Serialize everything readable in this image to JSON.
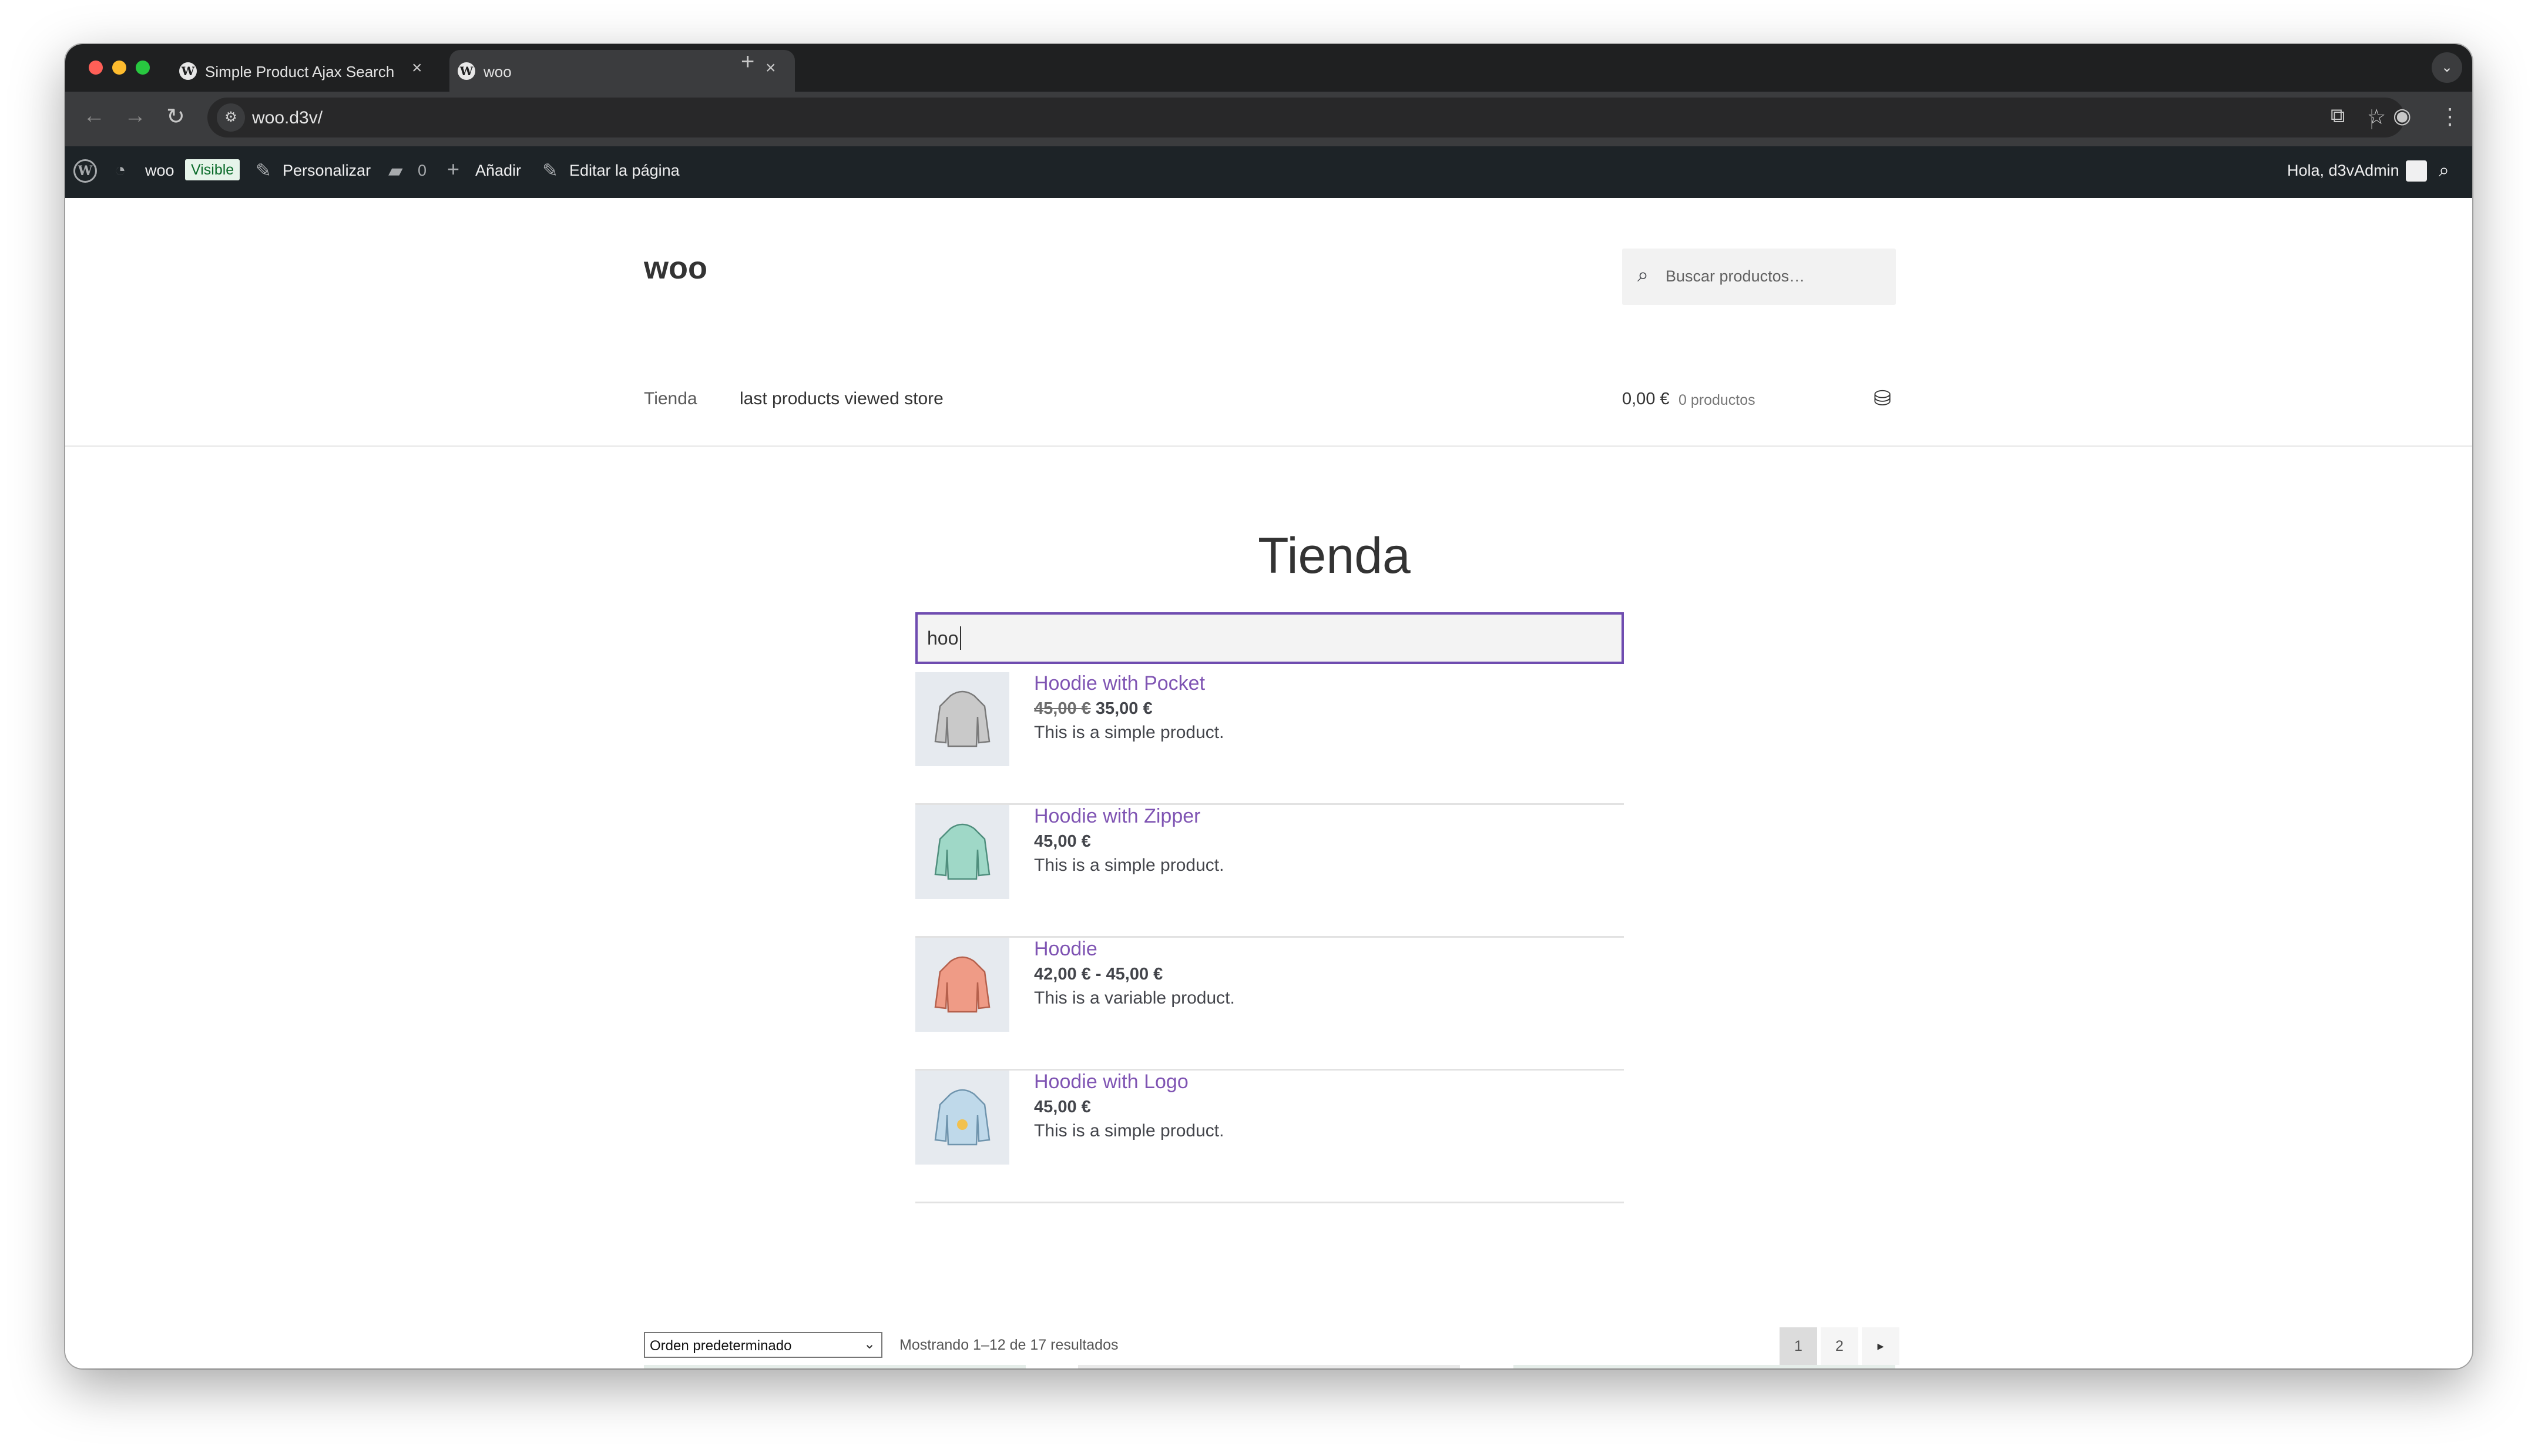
{
  "browser": {
    "tabs": [
      {
        "title": "Simple Product Ajax Search E",
        "active": false
      },
      {
        "title": "woo",
        "active": true
      }
    ],
    "url": "woo.d3v/"
  },
  "admin_bar": {
    "site_name": "woo",
    "visible_badge": "Visible",
    "customize": "Personalizar",
    "comments_count": "0",
    "add_new": "Añadir",
    "edit_page": "Editar la página",
    "greeting": "Hola, d3vAdmin"
  },
  "site": {
    "title": "woo",
    "search_placeholder": "Buscar productos…",
    "nav": [
      "Tienda",
      "last products viewed store"
    ],
    "cart_amount": "0,00 €",
    "cart_count": "0 productos"
  },
  "main": {
    "heading": "Tienda",
    "search_value": "hoo",
    "results": [
      {
        "name": "Hoodie with Pocket",
        "price_old": "45,00 €",
        "price": "35,00 €",
        "description": "This is a simple product.",
        "color": "#c9c9c9"
      },
      {
        "name": "Hoodie with Zipper",
        "price": "45,00 €",
        "description": "This is a simple product.",
        "color": "#9fd8c7"
      },
      {
        "name": "Hoodie",
        "price": "42,00 € - 45,00 €",
        "description": "This is a variable product.",
        "color": "#ef9b86"
      },
      {
        "name": "Hoodie with Logo",
        "price": "45,00 €",
        "description": "This is a simple product.",
        "color": "#bfd9ea"
      }
    ],
    "sort_selected": "Orden predeterminado",
    "result_count": "Mostrando 1–12 de 17 resultados",
    "pagination": [
      "1",
      "2"
    ]
  }
}
